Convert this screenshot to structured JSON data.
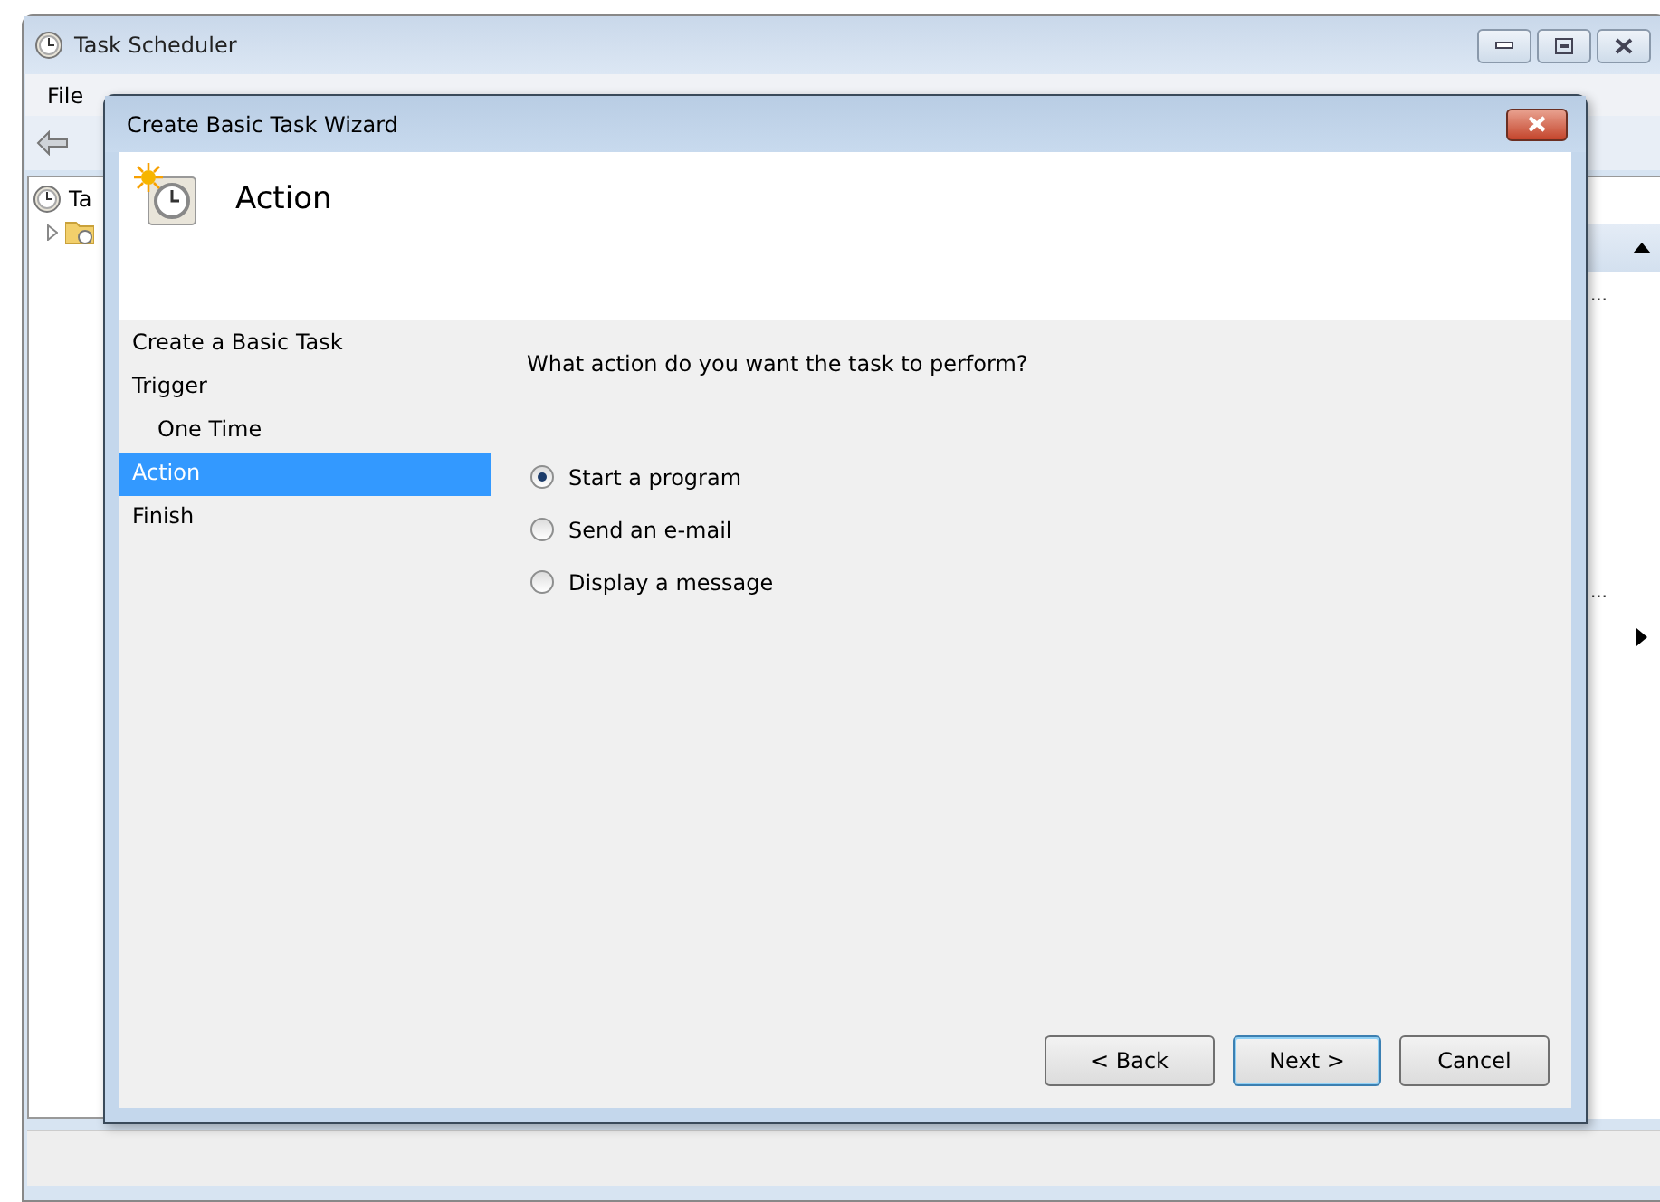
{
  "main_window": {
    "title": "Task Scheduler",
    "menu": [
      "File"
    ],
    "tree": [
      {
        "label": "Ta",
        "children": [
          {
            "expanded": false
          }
        ]
      }
    ],
    "right_pane": {
      "fragments": [
        "...",
        "..."
      ]
    }
  },
  "wizard": {
    "title": "Create Basic Task Wizard",
    "heading": "Action",
    "steps": [
      {
        "label": "Create a Basic Task",
        "selected": false
      },
      {
        "label": "Trigger",
        "selected": false,
        "children": [
          {
            "label": "One Time",
            "selected": false
          }
        ]
      },
      {
        "label": "Action",
        "selected": true
      },
      {
        "label": "Finish",
        "selected": false
      }
    ],
    "question": "What action do you want the task to perform?",
    "options": [
      {
        "label": "Start a program",
        "selected": true
      },
      {
        "label": "Send an e-mail",
        "selected": false
      },
      {
        "label": "Display a message",
        "selected": false
      }
    ],
    "buttons": [
      {
        "label": "< Back",
        "default": false
      },
      {
        "label": "Next >",
        "default": true
      },
      {
        "label": "Cancel",
        "default": false
      }
    ]
  }
}
